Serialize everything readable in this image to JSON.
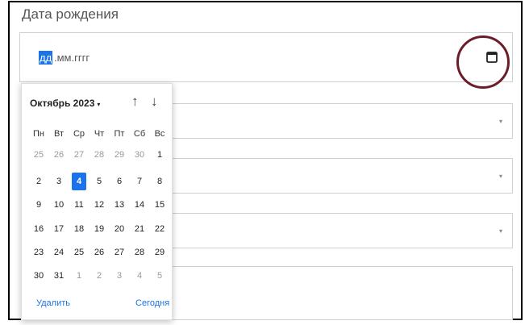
{
  "field": {
    "label": "Дата рождения",
    "day_segment": "дд",
    "rest_segments": ".мм.гггг"
  },
  "icons": {
    "calendar": "calendar-icon",
    "caret": "chevron-down-icon"
  },
  "colors": {
    "accent": "#1a73e8",
    "annotation_circle": "#6b1e2a"
  },
  "calendar": {
    "month_label": "Октябрь 2023",
    "month_arrow": "▾",
    "nav_up": "↑",
    "nav_down": "↓",
    "weekdays": [
      "Пн",
      "Вт",
      "Ср",
      "Чт",
      "Пт",
      "Сб",
      "Вс"
    ],
    "weeks": [
      [
        "25",
        "26",
        "27",
        "28",
        "29",
        "30",
        "1"
      ],
      [
        "2",
        "3",
        "4",
        "5",
        "6",
        "7",
        "8"
      ],
      [
        "9",
        "10",
        "11",
        "12",
        "13",
        "14",
        "15"
      ],
      [
        "16",
        "17",
        "18",
        "19",
        "20",
        "21",
        "22"
      ],
      [
        "23",
        "24",
        "25",
        "26",
        "27",
        "28",
        "29"
      ],
      [
        "30",
        "31",
        "1",
        "2",
        "3",
        "4",
        "5"
      ]
    ],
    "selected_day": "4",
    "clear_label": "Удалить",
    "today_label": "Сегодня"
  },
  "selects": [
    {
      "caret": "▾"
    },
    {
      "caret": "▾"
    },
    {
      "caret": "▾"
    }
  ]
}
